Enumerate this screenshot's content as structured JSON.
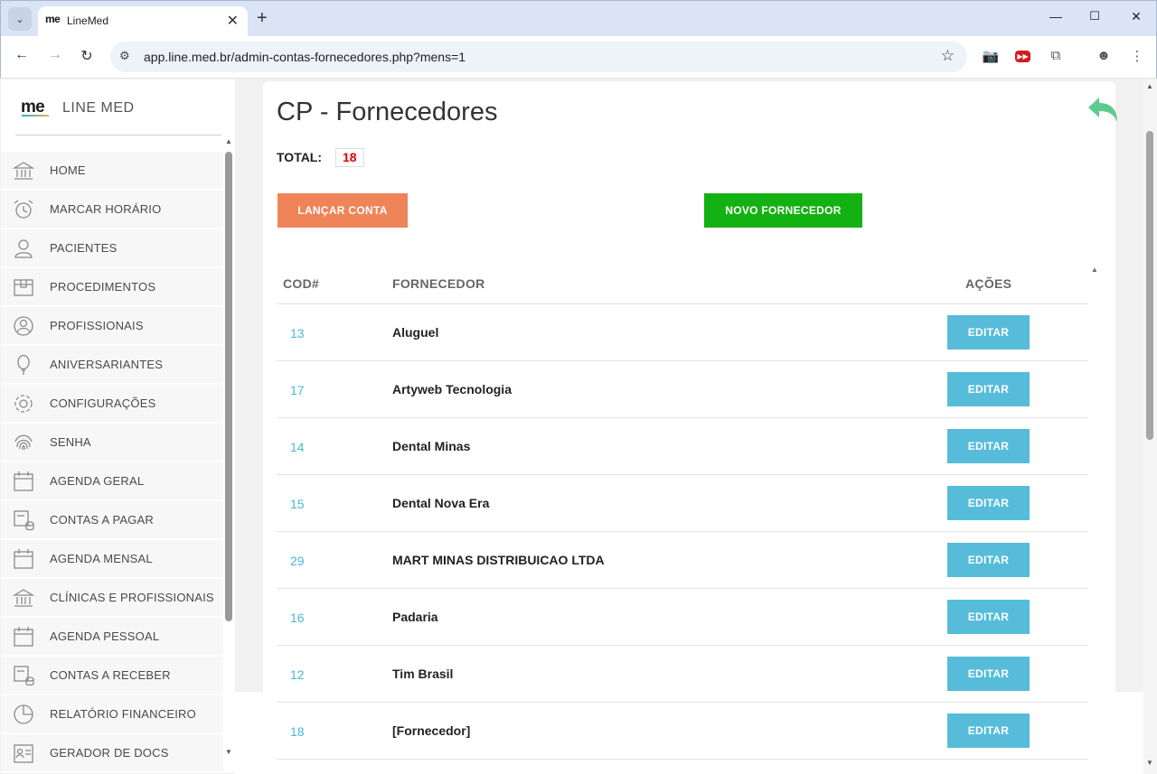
{
  "browser": {
    "tab_title": "LineMed",
    "tab_favicon": "me",
    "url": "app.line.med.br/admin-contas-fornecedores.php?mens=1",
    "icons": [
      "back-icon",
      "forward-icon",
      "reload-icon",
      "site-info-icon",
      "bookmark-star-icon",
      "camera-icon",
      "youtube-icon",
      "extensions-icon",
      "profile-icon",
      "menu-icon"
    ]
  },
  "sidebar": {
    "logo": "me",
    "brand": "LINE MED",
    "items": [
      {
        "label": "HOME",
        "icon": "bank-icon"
      },
      {
        "label": "MARCAR HORÁRIO",
        "icon": "alarm-clock-icon"
      },
      {
        "label": "PACIENTES",
        "icon": "user-icon"
      },
      {
        "label": "PROCEDIMENTOS",
        "icon": "box-icon"
      },
      {
        "label": "PROFISSIONAIS",
        "icon": "user-circle-icon"
      },
      {
        "label": "ANIVERSARIANTES",
        "icon": "balloon-icon"
      },
      {
        "label": "CONFIGURAÇÕES",
        "icon": "gear-icon"
      },
      {
        "label": "SENHA",
        "icon": "fingerprint-icon"
      },
      {
        "label": "AGENDA GERAL",
        "icon": "calendar-icon"
      },
      {
        "label": "CONTAS A PAGAR",
        "icon": "bill-coins-icon"
      },
      {
        "label": "AGENDA MENSAL",
        "icon": "calendar-icon"
      },
      {
        "label": "CLÍNICAS E PROFISSIONAIS",
        "icon": "bank-icon"
      },
      {
        "label": "AGENDA PESSOAL",
        "icon": "calendar-icon"
      },
      {
        "label": "CONTAS A RECEBER",
        "icon": "bill-coins-icon"
      },
      {
        "label": "RELATÓRIO FINANCEIRO",
        "icon": "pie-chart-icon"
      },
      {
        "label": "GERADOR DE DOCS",
        "icon": "id-card-icon"
      }
    ]
  },
  "main": {
    "title": "CP - Fornecedores",
    "total_label": "TOTAL:",
    "total_value": "18",
    "btn_lancar": "LANÇAR CONTA",
    "btn_novo": "NOVO FORNECEDOR",
    "table": {
      "headers": {
        "cod": "COD#",
        "fornecedor": "FORNECEDOR",
        "acoes": "AÇÕES"
      },
      "edit_label": "EDITAR",
      "rows": [
        {
          "cod": "13",
          "name": "Aluguel"
        },
        {
          "cod": "17",
          "name": "Artyweb Tecnologia"
        },
        {
          "cod": "14",
          "name": "Dental Minas"
        },
        {
          "cod": "15",
          "name": "Dental Nova Era"
        },
        {
          "cod": "29",
          "name": "MART MINAS DISTRIBUICAO LTDA"
        },
        {
          "cod": "16",
          "name": "Padaria"
        },
        {
          "cod": "12",
          "name": "Tim Brasil"
        },
        {
          "cod": "18",
          "name": "[Fornecedor]"
        }
      ]
    }
  },
  "colors": {
    "lancar": "#ef8458",
    "novo": "#14b112",
    "editar": "#56bcd9",
    "cod_link": "#46b9d6",
    "total_value": "#e00000",
    "back_arrow": "#5ccb8f"
  }
}
